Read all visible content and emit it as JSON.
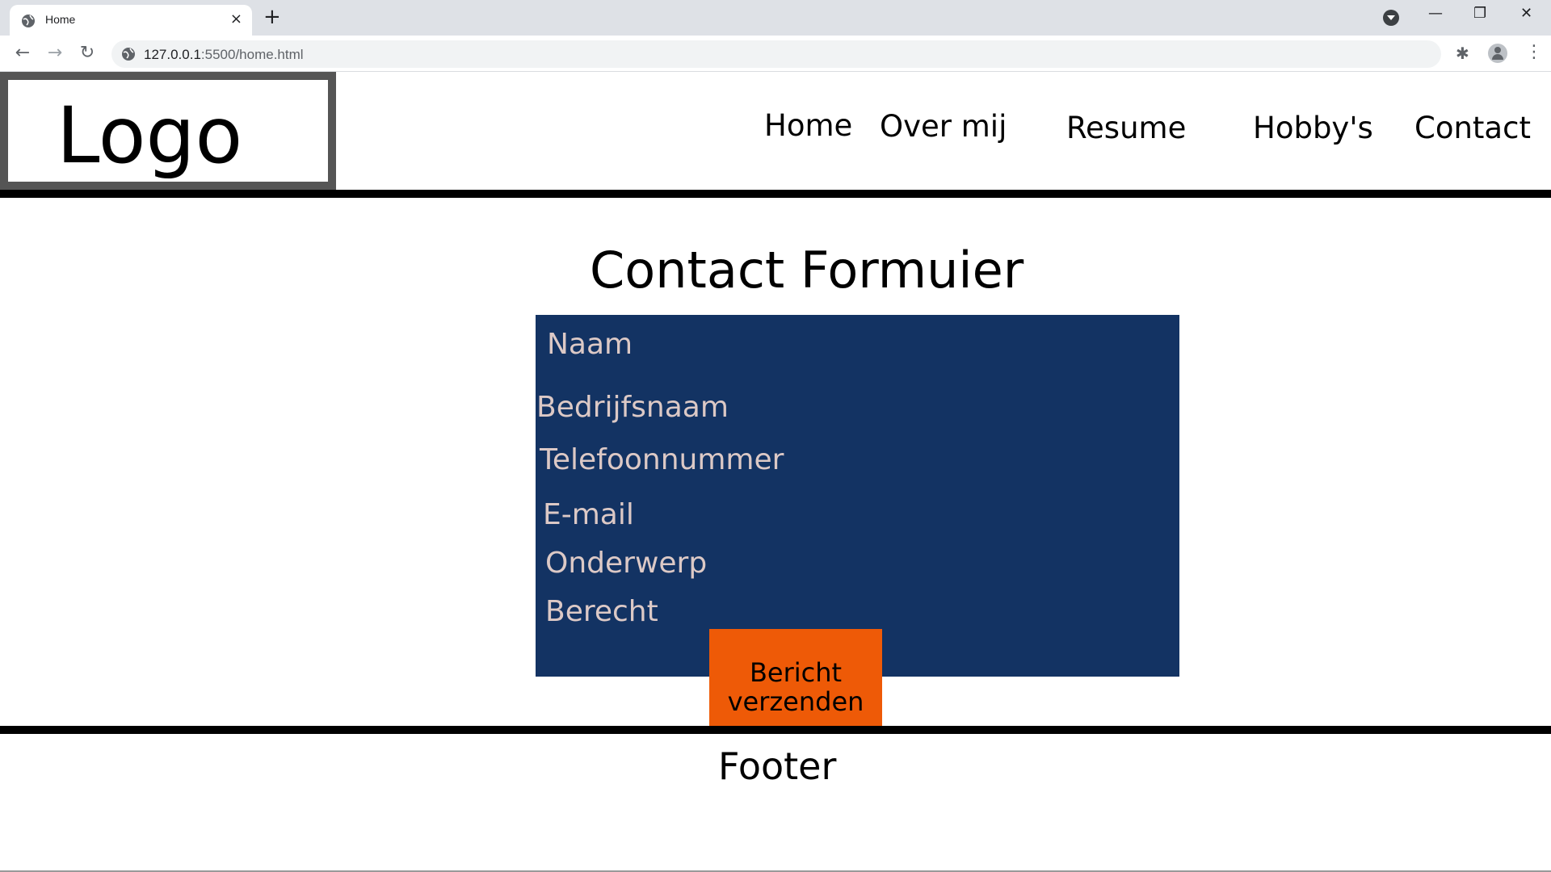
{
  "browser": {
    "tab_title": "Home",
    "tab_close": "×",
    "new_tab": "+",
    "url_host": "127.0.0.1",
    "url_rest": ":5500/home.html",
    "back": "←",
    "forward": "→",
    "reload": "↻",
    "minimize": "—",
    "restore": "❐",
    "close": "✕",
    "extensions": "✱",
    "menu": "⋮"
  },
  "header": {
    "logo": "Logo",
    "nav": [
      "Home",
      "Over mij",
      "Resume",
      "Hobby's",
      "Contact"
    ]
  },
  "main": {
    "title": "Contact Formuier",
    "fields": [
      "Naam",
      "Bedrijfsnaam",
      "Telefoonnummer",
      "E-mail",
      "Onderwerp",
      "Berecht"
    ],
    "submit_line1": "Bericht",
    "submit_line2": "verzenden"
  },
  "footer": {
    "text": "Footer"
  },
  "colors": {
    "form_bg": "#133363",
    "field_text": "#dcc9c6",
    "submit_bg": "#ee5a07",
    "logo_border": "#555555"
  }
}
